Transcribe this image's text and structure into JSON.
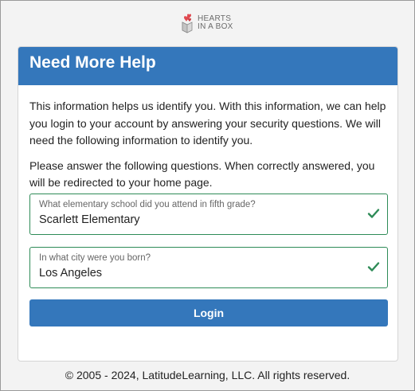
{
  "brand": {
    "line1": "HEARTS",
    "line2": "IN A BOX",
    "accent": "#e0484f"
  },
  "header": {
    "title": "Need More Help",
    "color": "#3477bb"
  },
  "intro": {
    "paragraph1": "This information helps us identify you. With this information, we can help you login to your account by answering your security questions. We will need the following information to identify you.",
    "paragraph2": "Please answer the following questions. When correctly answered, you will be redirected to your home page."
  },
  "questions": [
    {
      "label": "What elementary school did you attend in fifth grade?",
      "value": "Scarlett Elementary",
      "status_icon": "check-icon",
      "status_color": "#2e8b57"
    },
    {
      "label": "In what city were you born?",
      "value": "Los Angeles",
      "status_icon": "check-icon",
      "status_color": "#2e8b57"
    }
  ],
  "login": {
    "label": "Login"
  },
  "footer": {
    "text": "© 2005 - 2024, LatitudeLearning, LLC. All rights reserved."
  }
}
